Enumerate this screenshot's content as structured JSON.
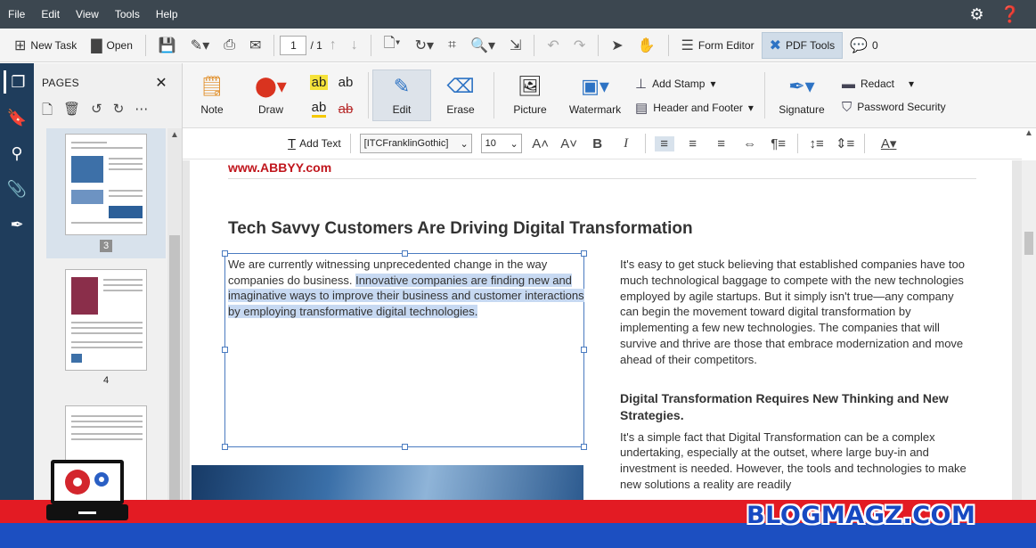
{
  "menu": [
    "File",
    "Edit",
    "View",
    "Tools",
    "Help"
  ],
  "menu_right": {
    "settings_icon": "gear-icon",
    "help_icon": "help-icon"
  },
  "toolbar": {
    "new_task": "New Task",
    "open": "Open",
    "page_current": "1",
    "page_total": "/ 1",
    "form_editor": "Form Editor",
    "pdf_tools": "PDF Tools",
    "comments_count": "0"
  },
  "pages_panel": {
    "title": "PAGES",
    "thumb_labels": [
      "3",
      "4"
    ]
  },
  "ribbon": {
    "note": "Note",
    "draw": "Draw",
    "hl_labels": [
      "ab",
      "ab",
      "ab",
      "ab"
    ],
    "edit": "Edit",
    "erase": "Erase",
    "picture": "Picture",
    "watermark": "Watermark",
    "add_stamp": "Add Stamp",
    "header_footer": "Header and Footer",
    "signature": "Signature",
    "redact": "Redact",
    "password_security": "Password Security"
  },
  "format_bar": {
    "add_text": "Add Text",
    "font": "[ITCFranklinGothic]",
    "size": "10",
    "bold": "B",
    "italic": "I",
    "font_color": "A"
  },
  "document": {
    "url": "www.ABBYY.com",
    "title": "Tech Savvy Customers Are Driving Digital Transformation",
    "left_plain": "We are currently witnessing unprecedented change in the way companies do business. ",
    "left_selected": "Innovative companies are finding new and imaginative ways to improve their business and customer interactions by employing transformative digital technologies.",
    "right_p1": "It's easy to get stuck believing that established companies have too much technological baggage to compete with the new technologies employed by agile startups. But it simply isn't true—any company can begin the movement toward digital transformation by implementing a few new technologies. The companies that will survive and thrive are those that embrace modernization and move ahead of their competitors.",
    "right_h3": "Digital Transformation Requires New Thinking and New Strategies.",
    "right_p2": "It's a simple fact that Digital Transformation can be a complex undertaking, especially at the outset, where large buy-in and investment is needed. However, the tools and technologies to make new solutions a reality are readily"
  },
  "watermark": {
    "brand": "BLOGMAGZ.COM"
  },
  "colors": {
    "menubar": "#3c4750",
    "sidebar": "#1f3d5c",
    "selection": "#c7d9f2",
    "url_red": "#c0161d",
    "footer_red": "#e31b23",
    "footer_blue": "#1c4fc1"
  }
}
